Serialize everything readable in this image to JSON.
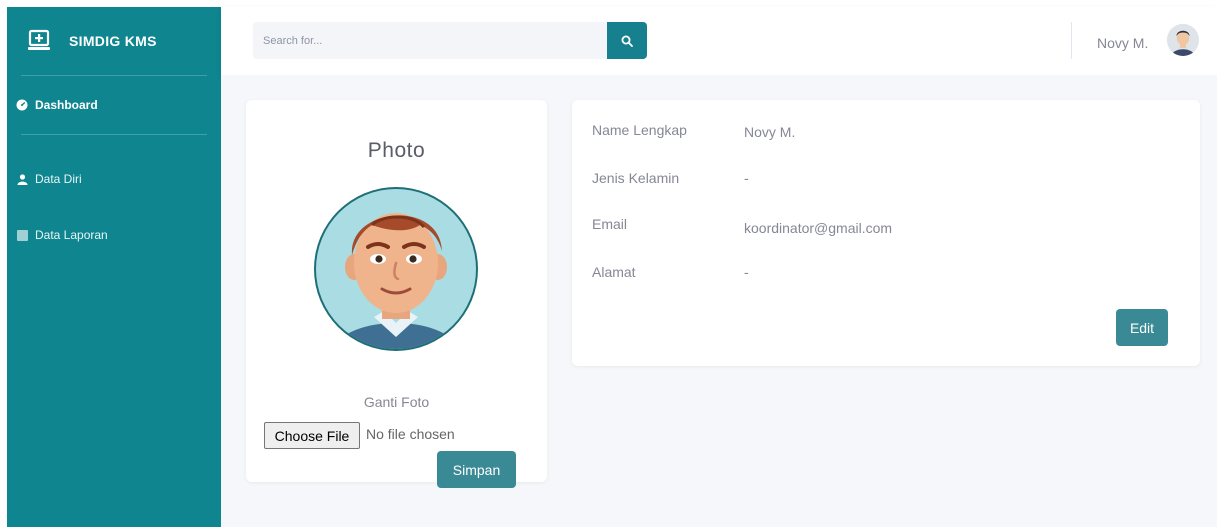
{
  "sidebar": {
    "brand": "SIMDIG KMS",
    "items": [
      {
        "label": "Dashboard",
        "icon": "tachometer-icon"
      },
      {
        "label": "Data Diri",
        "icon": "user-icon"
      },
      {
        "label": "Data Laporan",
        "icon": "table-icon"
      }
    ]
  },
  "topbar": {
    "search_placeholder": "Search for...",
    "user_name": "Novy M."
  },
  "photo_card": {
    "title": "Photo",
    "change_label": "Ganti Foto",
    "choose_file_label": "Choose File",
    "no_file_text": "No file chosen",
    "save_label": "Simpan"
  },
  "profile": {
    "rows": [
      {
        "label": "Name Lengkap",
        "value": "Novy M."
      },
      {
        "label": "Jenis Kelamin",
        "value": "-"
      },
      {
        "label": "Email",
        "value": "koordinator@gmail.com"
      },
      {
        "label": "Alamat",
        "value": "-"
      }
    ],
    "edit_label": "Edit"
  },
  "colors": {
    "primary": "#0e858f",
    "button": "#3a8a95",
    "background": "#f5f7fa"
  }
}
